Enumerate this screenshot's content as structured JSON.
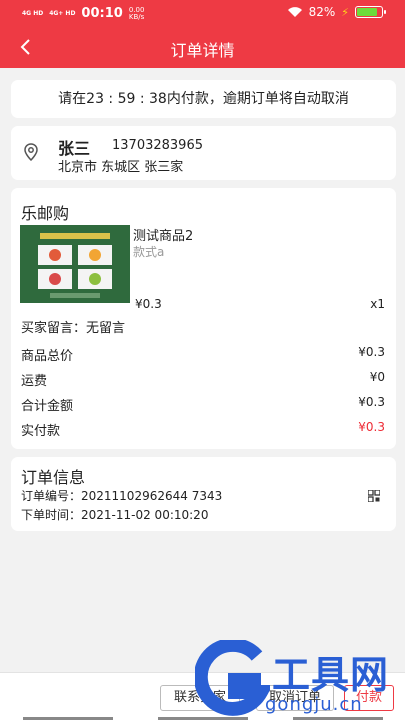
{
  "status": {
    "signal1": "4G HD",
    "signal2": "4G+ HD",
    "time": "00:10",
    "speed_value": "0.00",
    "speed_unit": "KB/s",
    "battery": "82%"
  },
  "nav": {
    "title": "订单详情"
  },
  "countdown": {
    "text": "请在23 : 59 : 38内付款，逾期订单将自动取消"
  },
  "address": {
    "name": "张三",
    "phone": "13703283965",
    "detail": "北京市 东城区 张三家"
  },
  "order": {
    "shop": "乐邮购",
    "product_name": "测试商品2",
    "spec": "款式a",
    "price": "¥0.3",
    "quantity": "x1",
    "note": "买家留言：无留言",
    "rows": [
      {
        "label": "商品总价",
        "value": "¥0.3"
      },
      {
        "label": "运费",
        "value": "¥0"
      },
      {
        "label": "合计金额",
        "value": "¥0.3"
      },
      {
        "label": "实付款",
        "value": "¥0.3"
      }
    ]
  },
  "info": {
    "title": "订单信息",
    "order_no": "订单编号：20211102962644 7343",
    "order_time": "下单时间：2021-11-02 00:10:20"
  },
  "actions": {
    "contact": "联系卖家",
    "cancel": "取消订单",
    "pay": "付款"
  },
  "watermark": {
    "brand": "工具网",
    "domain": "gongju.cn"
  },
  "colors": {
    "accent": "#ee3a44",
    "price_red": "#ee2b35",
    "watermark": "#2a5fd4"
  }
}
